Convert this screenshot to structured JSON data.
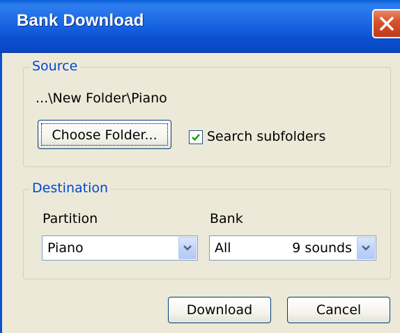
{
  "window": {
    "title": "Bank Download"
  },
  "source": {
    "legend": "Source",
    "path": "...\\New Folder\\Piano",
    "choose_folder_label": "Choose Folder...",
    "search_subfolders_label": "Search subfolders",
    "search_subfolders_checked": true
  },
  "destination": {
    "legend": "Destination",
    "partition_label": "Partition",
    "partition_value": "Piano",
    "bank_label": "Bank",
    "bank_value": "All",
    "bank_count": "9 sounds"
  },
  "buttons": {
    "download_label": "Download",
    "cancel_label": "Cancel"
  },
  "colors": {
    "titlebar": "#0B4FD1",
    "dialog_bg": "#ECE9D8",
    "legend_text": "#0046D5",
    "close_button": "#D7532E",
    "checkmark": "#21A121"
  },
  "icons": {
    "close": "close-icon",
    "checkmark": "checkmark-icon",
    "dropdown": "chevron-down-icon"
  }
}
